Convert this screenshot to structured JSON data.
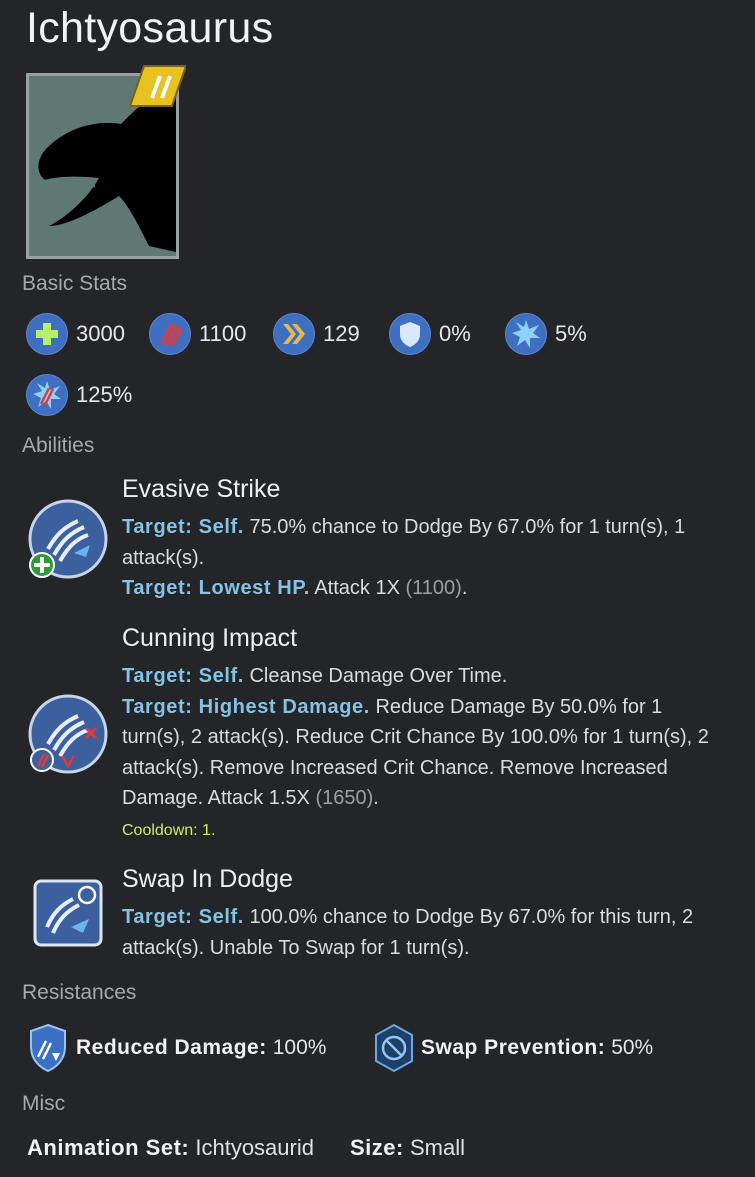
{
  "title": "Ichtyosaurus",
  "sections": {
    "basic_stats": "Basic Stats",
    "abilities": "Abilities",
    "resistances": "Resistances",
    "misc": "Misc"
  },
  "stats": [
    {
      "icon": "health-icon",
      "value": "3000"
    },
    {
      "icon": "damage-icon",
      "value": "1100"
    },
    {
      "icon": "speed-icon",
      "value": "129"
    },
    {
      "icon": "armor-icon",
      "value": "0%"
    },
    {
      "icon": "crit-chance-icon",
      "value": "5%"
    },
    {
      "icon": "crit-multiplier-icon",
      "value": "125%"
    }
  ],
  "abilities": [
    {
      "name": "Evasive Strike",
      "lines": [
        {
          "target": "Target: Self.",
          "text": " 75.0% chance to Dodge By 67.0% for 1 turn(s), 1 attack(s)."
        },
        {
          "target": "Target: Lowest HP.",
          "text": " Attack 1X ",
          "num": "(1100)",
          "tail": "."
        }
      ]
    },
    {
      "name": "Cunning Impact",
      "lines": [
        {
          "target": "Target: Self.",
          "text": " Cleanse Damage Over Time."
        },
        {
          "target": "Target: Highest Damage.",
          "text": " Reduce Damage By 50.0% for 1 turn(s), 2 attack(s). Reduce Crit Chance By 100.0% for 1 turn(s), 2 attack(s). Remove Increased Crit Chance. Remove Increased Damage. Attack 1.5X ",
          "num": "(1650)",
          "tail": "."
        }
      ],
      "cooldown": "Cooldown: 1."
    },
    {
      "name": "Swap In Dodge",
      "lines": [
        {
          "target": "Target: Self.",
          "text": " 100.0% chance to Dodge By 67.0% for this turn, 2 attack(s). Unable To Swap for 1 turn(s)."
        }
      ]
    }
  ],
  "resistances": [
    {
      "label": "Reduced Damage:",
      "value": "100%"
    },
    {
      "label": "Swap Prevention:",
      "value": "50%"
    }
  ],
  "misc": {
    "animation_label": "Animation Set:",
    "animation_value": "Ichtyosaurid",
    "size_label": "Size:",
    "size_value": "Small"
  },
  "colors": {
    "background": "#232529",
    "target_text": "#86c3e3",
    "cooldown_text": "#d8e86a",
    "stat_icon": "#3f6fc0"
  }
}
